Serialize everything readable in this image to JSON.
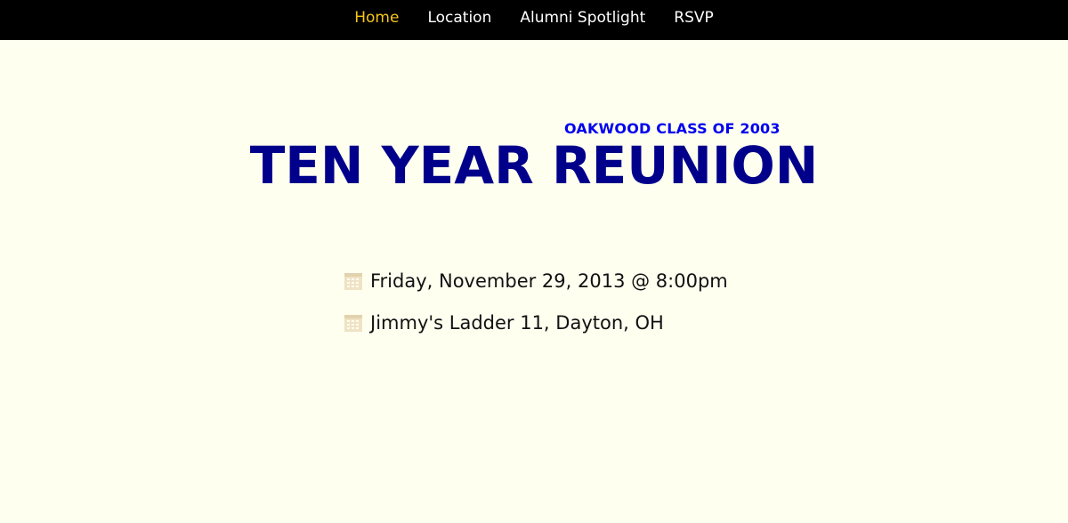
{
  "nav": {
    "items": [
      {
        "label": "Home"
      },
      {
        "label": "Location"
      },
      {
        "label": "Alumni Spotlight"
      },
      {
        "label": "RSVP"
      }
    ],
    "active_index": 0
  },
  "hero": {
    "subtitle": "OAKWOOD CLASS OF 2003",
    "title": "TEN YEAR REUNION"
  },
  "details": {
    "date": {
      "icon": "calendar-icon",
      "text": "Friday, November 29, 2013 @ 8:00pm"
    },
    "location": {
      "icon": "calendar-icon",
      "text": "Jimmy's Ladder 11, Dayton, OH"
    }
  },
  "colors": {
    "nav_bg": "#000000",
    "nav_text": "#ffffff",
    "nav_active": "#f5c518",
    "page_bg": "#fffff0",
    "subtitle": "#0000ee",
    "title": "#00008b",
    "icon": "#efe3c4"
  }
}
